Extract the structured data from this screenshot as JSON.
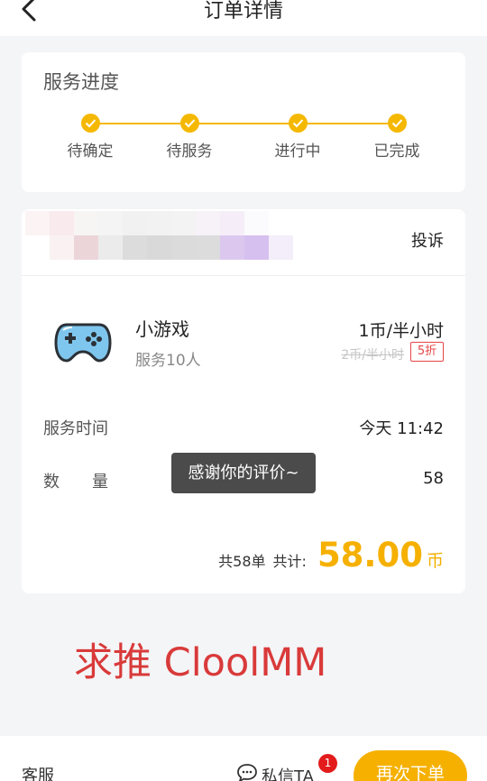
{
  "header": {
    "title": "订单详情"
  },
  "progress": {
    "title": "服务进度",
    "steps": [
      {
        "label": "待确定"
      },
      {
        "label": "待服务"
      },
      {
        "label": "进行中"
      },
      {
        "label": "已完成"
      }
    ],
    "accent": "#f5b800"
  },
  "order": {
    "complaint_label": "投诉",
    "game_name": "小游戏",
    "service_count": "服务10人",
    "price": "1币/半小时",
    "original_price": "2币/半小时",
    "discount": "5折",
    "service_time_label": "服务时间",
    "service_time_value": "今天 11:42",
    "quantity_label": "数　　量",
    "quantity_value": "58",
    "total_count": "共58单",
    "total_label": "共计:",
    "total_amount": "58.00",
    "total_unit": "币"
  },
  "toast": {
    "text": "感谢你的评价~"
  },
  "watermark": {
    "text": "求推  CloolMM"
  },
  "bottom": {
    "service_label": "客服",
    "private_msg_label": "私信TA",
    "msg_badge": "1",
    "reorder_label": "再次下单"
  },
  "colors": {
    "accent": "#f5b000",
    "badge": "#e31b1b",
    "watermark": "#d93a3a"
  }
}
